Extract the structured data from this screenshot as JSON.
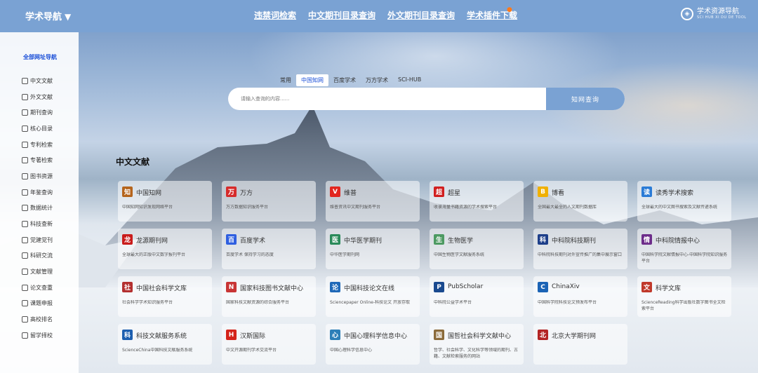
{
  "brand": {
    "title": "学术导航"
  },
  "top_nav": [
    "违禁词检索",
    "中文期刊目录查询",
    "外文期刊目录查询",
    "学术插件下载"
  ],
  "logo": {
    "name": "学术资源导航",
    "sub": "SCI HUB XI DU DE TOOL"
  },
  "sidebar": {
    "title": "全部网址导航",
    "items": [
      "中文文献",
      "外文文献",
      "期刊查询",
      "核心目录",
      "专利检索",
      "专著检索",
      "图书资源",
      "年鉴查询",
      "数据统计",
      "科技查新",
      "党建党刊",
      "科研交流",
      "文献管理",
      "论文查重",
      "课题申报",
      "高校排名",
      "留学择校"
    ]
  },
  "search": {
    "tabs": [
      "常用",
      "中国知网",
      "百度学术",
      "万方学术",
      "SCI-HUB"
    ],
    "active_tab": "中国知网",
    "placeholder": "请输入查询的内容......",
    "button": "知网查询"
  },
  "section": {
    "title": "中文文献",
    "cards": [
      {
        "name": "中国知网",
        "desc": "中国知网知识发现网络平台",
        "color": "#b5651d",
        "glyph": "知"
      },
      {
        "name": "万方",
        "desc": "万方数据知识服务平台",
        "color": "#d62b2b",
        "glyph": "万"
      },
      {
        "name": "维普",
        "desc": "维普资讯中文期刊服务平台",
        "color": "#e2261f",
        "glyph": "V"
      },
      {
        "name": "超星",
        "desc": "收录海量书籍资源的学术搜索平台",
        "color": "#d11f1f",
        "glyph": "超"
      },
      {
        "name": "博看",
        "desc": "全国最大最全的人文期刊数据库",
        "color": "#f0b000",
        "glyph": "B"
      },
      {
        "name": "读秀学术搜索",
        "desc": "全球最大的中文图书搜索及文献传递系统",
        "color": "#2a7bd6",
        "glyph": "读"
      },
      {
        "name": "龙源期刊网",
        "desc": "全球最大的正版中文数字报刊平台",
        "color": "#c91c1c",
        "glyph": "龙"
      },
      {
        "name": "百度学术",
        "desc": "百度学术 保持学习的态度",
        "color": "#2f5fe0",
        "glyph": "百"
      },
      {
        "name": "中华医学期刊",
        "desc": "中华医学期刊网",
        "color": "#2a8a5a",
        "glyph": "医"
      },
      {
        "name": "生物医学",
        "desc": "中国生物医学文献服务系统",
        "color": "#4d9a62",
        "glyph": "生"
      },
      {
        "name": "中科院科技期刊",
        "desc": "中科院科技期刊对外宣传推广的集中展示窗口",
        "color": "#1e3f8a",
        "glyph": "科"
      },
      {
        "name": "中科院情报中心",
        "desc": "中国科学院文献情报中心-中国科学院知识服务平台",
        "color": "#6d2d8a",
        "glyph": "情"
      },
      {
        "name": "中国社会科学文库",
        "desc": "社会科学学术知识服务平台",
        "color": "#b33030",
        "glyph": "社"
      },
      {
        "name": "国家科技图书文献中心",
        "desc": "国家科技文献资源的综合服务平台",
        "color": "#c83535",
        "glyph": "N"
      },
      {
        "name": "中国科技论文在线",
        "desc": "Sciencepaper Online-科技论文 开放存取",
        "color": "#2069b8",
        "glyph": "论"
      },
      {
        "name": "PubScholar",
        "desc": "中科院公益学术平台",
        "color": "#1a4a8f",
        "glyph": "P"
      },
      {
        "name": "ChinaXiv",
        "desc": "中国科学院科技论文预发布平台",
        "color": "#1b63b5",
        "glyph": "C"
      },
      {
        "name": "科学文库",
        "desc": "ScienceReading科学出版社数字图书全文检索平台",
        "color": "#c0392b",
        "glyph": "文"
      },
      {
        "name": "科技文献服务系统",
        "desc": "ScienceChina中国科技文献服务系统",
        "color": "#1d5fb0",
        "glyph": "科"
      },
      {
        "name": "汉斯国际",
        "desc": "中文开源期刊学术交流平台",
        "color": "#d4231a",
        "glyph": "H"
      },
      {
        "name": "中国心理科学信息中心",
        "desc": "中国心理科学信息中心",
        "color": "#2d7fb8",
        "glyph": "心"
      },
      {
        "name": "国哲社会科学文献中心",
        "desc": "哲学、社会科学、文化科学等领域的期刊、古籍、文献检索服务的网站",
        "color": "#8b6a3a",
        "glyph": "国"
      },
      {
        "name": "北京大学期刊网",
        "desc": "",
        "color": "#b32424",
        "glyph": "北"
      }
    ]
  }
}
